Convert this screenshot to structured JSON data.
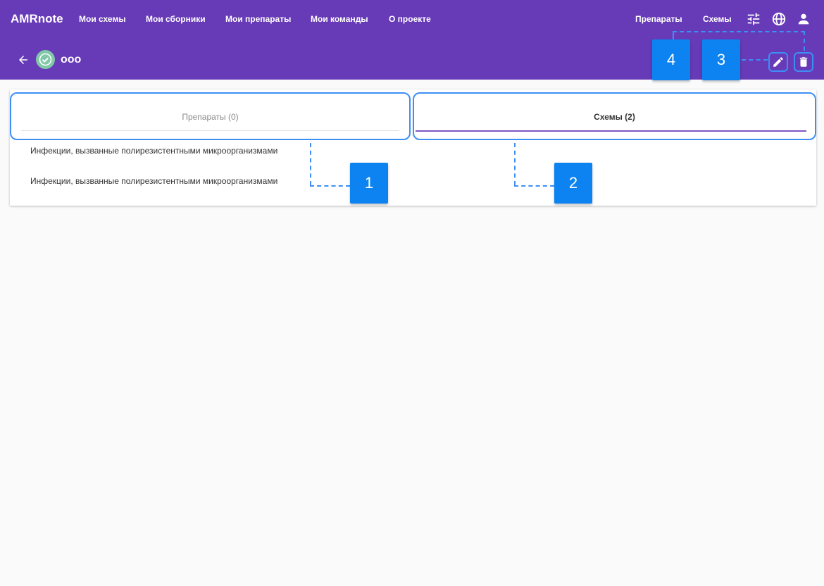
{
  "app": {
    "brand": "AMRnote"
  },
  "nav": {
    "items": [
      "Мои схемы",
      "Мои сборники",
      "Мои препараты",
      "Мои команды",
      "О проекте"
    ],
    "right_items": [
      "Препараты",
      "Схемы"
    ]
  },
  "header": {
    "title": "ooo"
  },
  "tabs": [
    {
      "label": "Препараты (0)"
    },
    {
      "label": "Схемы (2)"
    }
  ],
  "list": {
    "items": [
      "Инфекции, вызванные полирезистентными микроорганизмами",
      "Инфекции, вызванные полирезистентными микроорганизмами"
    ]
  },
  "callouts": [
    "1",
    "2",
    "3",
    "4"
  ],
  "colors": {
    "primary": "#673ab7",
    "accent": "#7e57c2",
    "callout": "#0d83f2",
    "highlight": "#3d8ff5"
  }
}
